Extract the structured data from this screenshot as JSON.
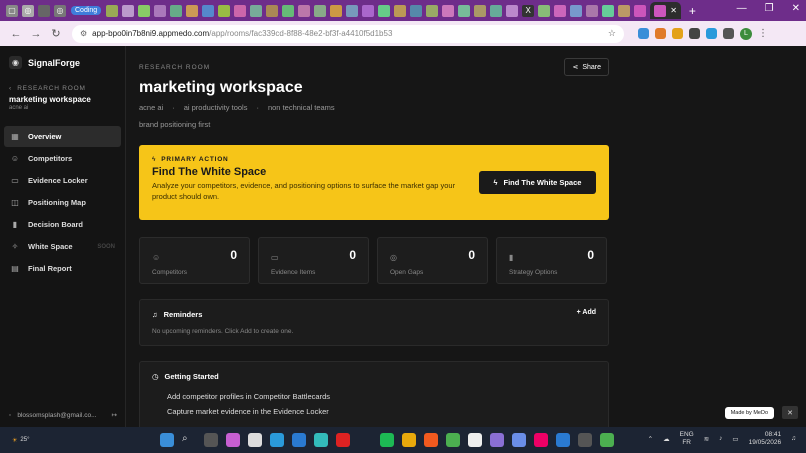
{
  "browser": {
    "active_tab_chip": "Coding",
    "url_host": "app-bpo0in7b8ni9.appmedo.com",
    "url_path": "/app/rooms/fac339cd-8f88-48e2-bf3f-a4410f5d1b53",
    "profile_initial": "L",
    "new_tab_symbol": "+"
  },
  "sidebar": {
    "brand": "SignalForge",
    "back_label": "RESEARCH ROOM",
    "room_name": "marketing workspace",
    "room_company": "acne ai",
    "items": [
      {
        "label": "Overview",
        "icon": "grid-icon",
        "glyph": "▦",
        "badge": ""
      },
      {
        "label": "Competitors",
        "icon": "users-icon",
        "glyph": "☺",
        "badge": ""
      },
      {
        "label": "Evidence Locker",
        "icon": "file-icon",
        "glyph": "▭",
        "badge": ""
      },
      {
        "label": "Positioning Map",
        "icon": "map-icon",
        "glyph": "◫",
        "badge": ""
      },
      {
        "label": "Decision Board",
        "icon": "bars-icon",
        "glyph": "▮",
        "badge": ""
      },
      {
        "label": "White Space",
        "icon": "star-icon",
        "glyph": "✧",
        "badge": "SOON"
      },
      {
        "label": "Final Report",
        "icon": "report-icon",
        "glyph": "▤",
        "badge": ""
      }
    ],
    "user_email": "blossomsplash@gmail.co..."
  },
  "header": {
    "kicker": "RESEARCH ROOM",
    "title": "marketing workspace",
    "meta": [
      "acne ai",
      "·",
      "ai productivity tools",
      "·",
      "non technical teams"
    ],
    "tagline": "brand positioning first",
    "share_label": "Share"
  },
  "hero": {
    "kicker": "PRIMARY ACTION",
    "title": "Find The White Space",
    "description": "Analyze your competitors, evidence, and positioning options to surface the market gap your product should own.",
    "button_label": "Find The White Space",
    "color": "#f6c518"
  },
  "stats": [
    {
      "label": "Competitors",
      "value": "0",
      "icon": "users-icon",
      "glyph": "☺"
    },
    {
      "label": "Evidence Items",
      "value": "0",
      "icon": "archive-icon",
      "glyph": "▭"
    },
    {
      "label": "Open Gaps",
      "value": "0",
      "icon": "target-icon",
      "glyph": "◎"
    },
    {
      "label": "Strategy Options",
      "value": "0",
      "icon": "bars-icon",
      "glyph": "▮"
    }
  ],
  "reminders": {
    "title": "Reminders",
    "add_label": "Add",
    "empty_text": "No upcoming reminders. Click Add to create one."
  },
  "getting_started": {
    "title": "Getting Started",
    "items": [
      "Add competitor profiles in Competitor Battlecards",
      "Capture market evidence in the Evidence Locker"
    ]
  },
  "made_by": "Made by MeDo",
  "taskbar": {
    "temp": "25°",
    "lang_top": "ENG",
    "lang_bottom": "FR",
    "time": "08:41",
    "date": "19/05/2026"
  }
}
